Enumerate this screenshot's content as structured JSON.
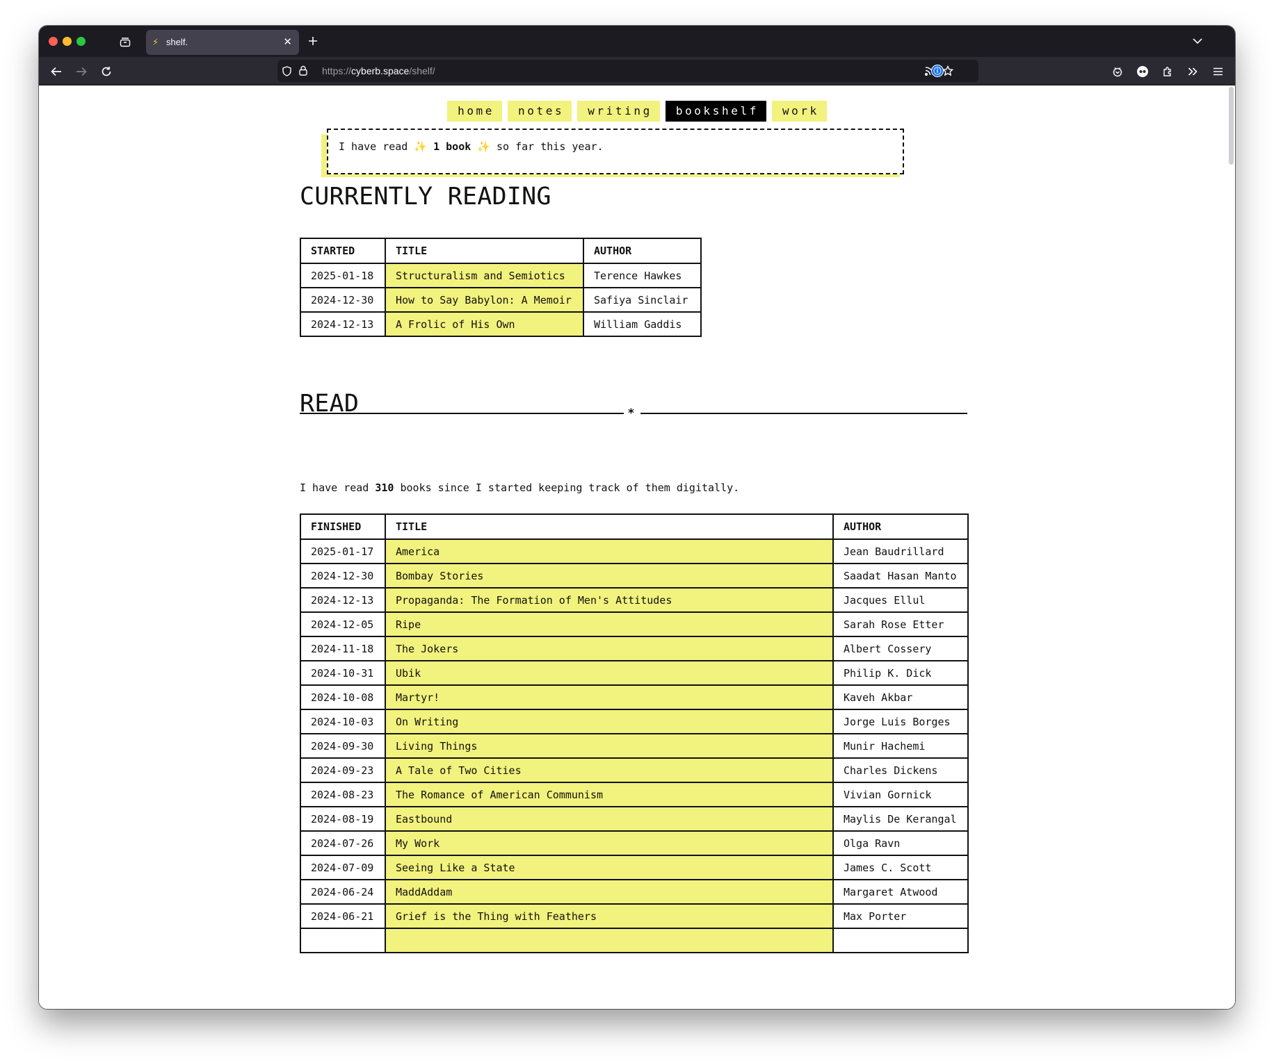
{
  "browser": {
    "tab_title": "shelf.",
    "tab_favicon": "⚡",
    "url_scheme": "https://",
    "url_host": "cyberb.space",
    "url_path": "/shelf/"
  },
  "nav": [
    "home",
    "notes",
    "writing",
    "bookshelf",
    "work"
  ],
  "nav_active": "bookshelf",
  "notice": {
    "prefix": "I have read",
    "count": "1 book",
    "suffix": "so far this year."
  },
  "currently_reading": {
    "heading": "CURRENTLY READING",
    "headers": [
      "STARTED",
      "TITLE",
      "AUTHOR"
    ],
    "rows": [
      [
        "2025-01-18",
        "Structuralism and Semiotics",
        "Terence Hawkes"
      ],
      [
        "2024-12-30",
        "How to Say Babylon: A Memoir",
        "Safiya Sinclair"
      ],
      [
        "2024-12-13",
        "A Frolic of His Own",
        "William Gaddis"
      ]
    ]
  },
  "read": {
    "heading": "READ",
    "intro_prefix": "I have read",
    "intro_count": "310",
    "intro_suffix": "books since I started keeping track of them digitally.",
    "headers": [
      "FINISHED",
      "TITLE",
      "AUTHOR"
    ],
    "rows": [
      [
        "2025-01-17",
        "America",
        "Jean Baudrillard"
      ],
      [
        "2024-12-30",
        "Bombay Stories",
        "Saadat Hasan Manto"
      ],
      [
        "2024-12-13",
        "Propaganda: The Formation of Men's Attitudes",
        "Jacques Ellul"
      ],
      [
        "2024-12-05",
        "Ripe",
        "Sarah Rose Etter"
      ],
      [
        "2024-11-18",
        "The Jokers",
        "Albert Cossery"
      ],
      [
        "2024-10-31",
        "Ubik",
        "Philip K. Dick"
      ],
      [
        "2024-10-08",
        "Martyr!",
        "Kaveh Akbar"
      ],
      [
        "2024-10-03",
        "On Writing",
        "Jorge Luis Borges"
      ],
      [
        "2024-09-30",
        "Living Things",
        "Munir Hachemi"
      ],
      [
        "2024-09-23",
        "A Tale of Two Cities",
        "Charles Dickens"
      ],
      [
        "2024-08-23",
        "The Romance of American Communism",
        "Vivian Gornick"
      ],
      [
        "2024-08-19",
        "Eastbound",
        "Maylis De Kerangal"
      ],
      [
        "2024-07-26",
        "My Work",
        "Olga Ravn"
      ],
      [
        "2024-07-09",
        "Seeing Like a State",
        "James C. Scott"
      ],
      [
        "2024-06-24",
        "MaddAddam",
        "Margaret Atwood"
      ],
      [
        "2024-06-21",
        "Grief is the Thing with Feathers",
        "Max Porter"
      ],
      [
        "",
        "",
        ""
      ]
    ]
  },
  "colors": {
    "highlight": "#f2f27e",
    "text": "#111111",
    "tab_strip": "#1c1b22",
    "toolbar": "#2b2a33"
  }
}
